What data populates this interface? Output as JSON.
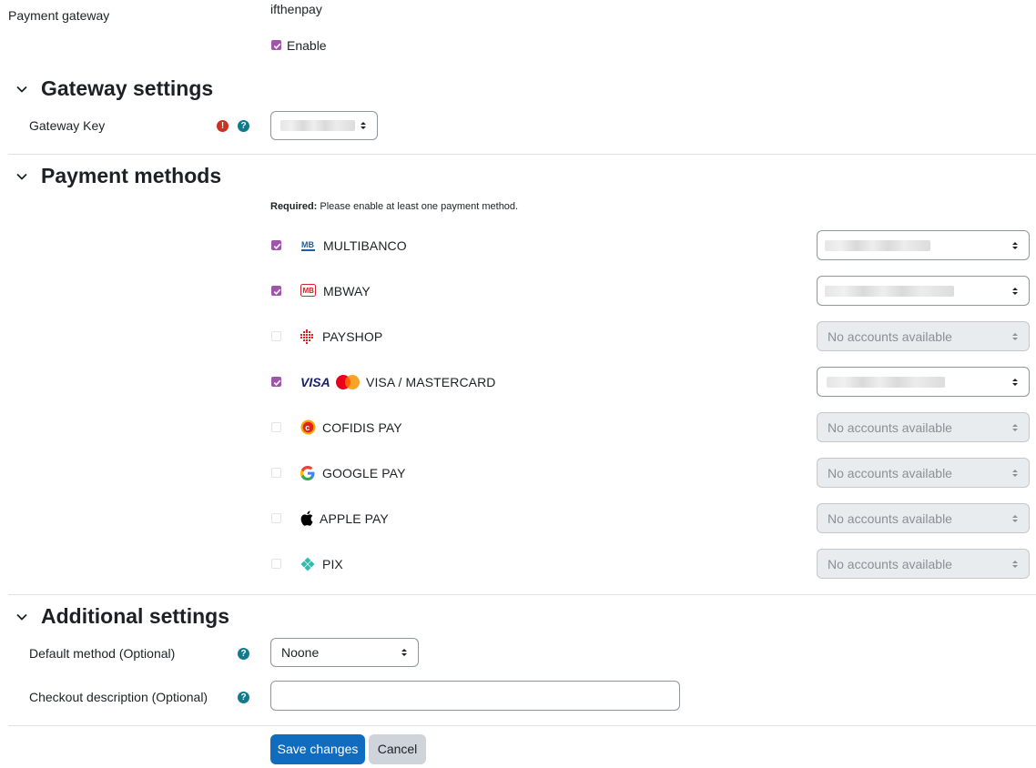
{
  "gateway": {
    "label": "Payment gateway",
    "name": "ifthenpay",
    "enable_label": "Enable",
    "enabled": true
  },
  "sections": {
    "gateway_settings": "Gateway settings",
    "payment_methods": "Payment methods",
    "additional_settings": "Additional settings"
  },
  "gateway_key": {
    "label": "Gateway Key"
  },
  "required_note": {
    "bold": "Required:",
    "text": " Please enable at least one payment method."
  },
  "methods": [
    {
      "name": "MULTIBANCO",
      "checked": true,
      "enabled": true,
      "account": "",
      "icon": "multibanco-icon"
    },
    {
      "name": "MBWAY",
      "checked": true,
      "enabled": true,
      "account": "",
      "icon": "mbway-icon"
    },
    {
      "name": "PAYSHOP",
      "checked": false,
      "enabled": false,
      "account": "No accounts available",
      "icon": "payshop-icon"
    },
    {
      "name": "VISA / MASTERCARD",
      "checked": true,
      "enabled": true,
      "account": "",
      "icon": "visa-mastercard-icon"
    },
    {
      "name": "COFIDIS PAY",
      "checked": false,
      "enabled": false,
      "account": "No accounts available",
      "icon": "cofidis-icon"
    },
    {
      "name": "GOOGLE PAY",
      "checked": false,
      "enabled": false,
      "account": "No accounts available",
      "icon": "google-icon"
    },
    {
      "name": "APPLE PAY",
      "checked": false,
      "enabled": false,
      "account": "No accounts available",
      "icon": "apple-icon"
    },
    {
      "name": "PIX",
      "checked": false,
      "enabled": false,
      "account": "No accounts available",
      "icon": "pix-icon"
    }
  ],
  "additional": {
    "default_method_label": "Default method (Optional)",
    "default_method_value": "Noone",
    "checkout_label": "Checkout description (Optional)",
    "checkout_value": ""
  },
  "buttons": {
    "save": "Save changes",
    "cancel": "Cancel"
  },
  "colors": {
    "checkbox": "#9e57a8",
    "primary": "#0f6cbf",
    "help": "#127a8a",
    "error": "#ca3120"
  }
}
